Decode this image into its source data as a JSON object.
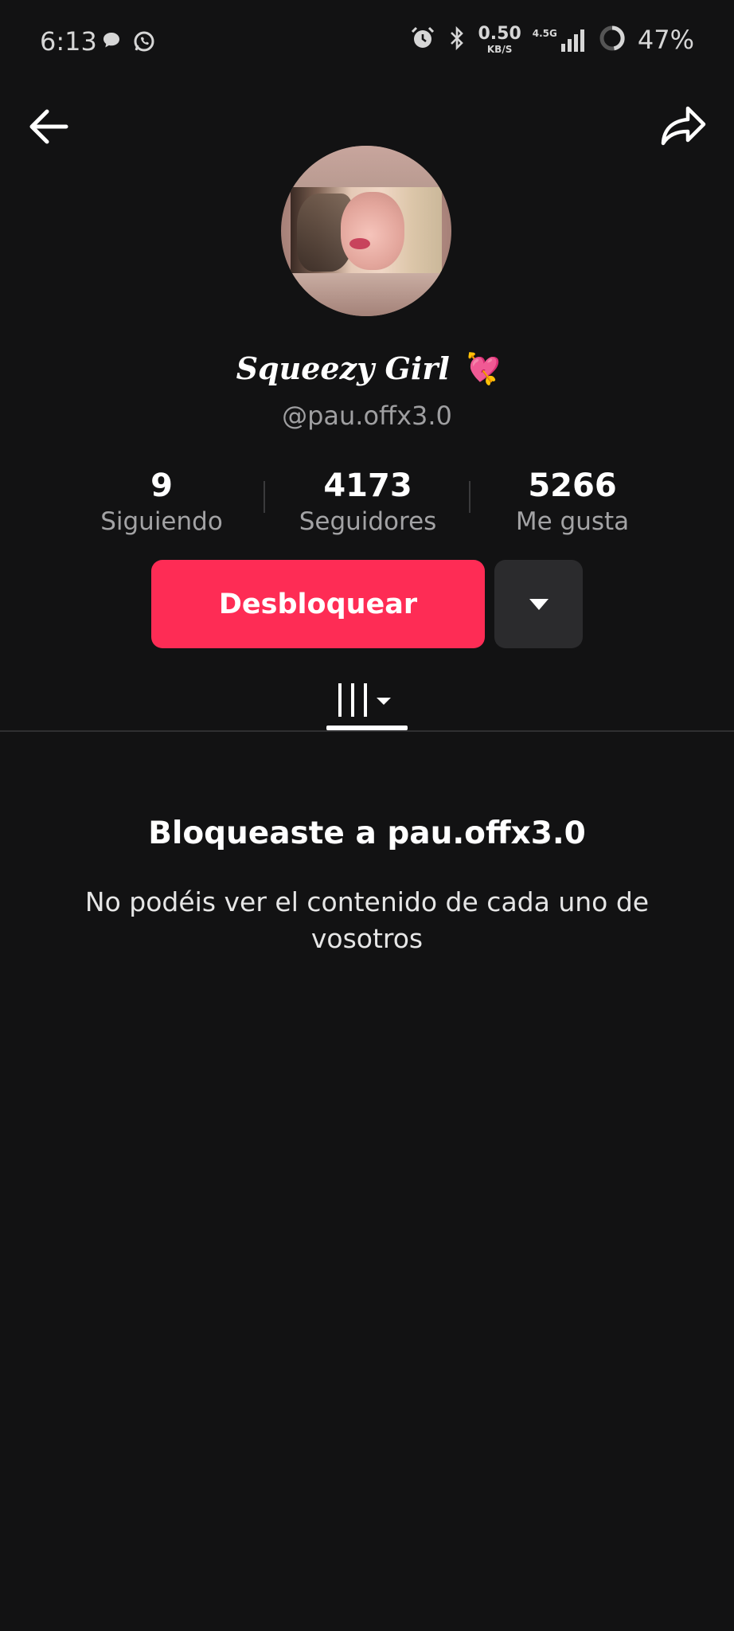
{
  "status_bar": {
    "time": "6:13",
    "net_speed_value": "0.50",
    "net_speed_unit": "KB/S",
    "network_type": "4.5G",
    "battery_percent": "47%",
    "icons": [
      "message-icon",
      "whatsapp-icon",
      "alarm-icon",
      "bluetooth-icon",
      "signal-icon",
      "battery-ring-icon"
    ]
  },
  "nav": {
    "back_icon": "arrow-left-icon",
    "share_icon": "share-arrow-icon"
  },
  "profile": {
    "display_name": "Squeezy Girl 💘",
    "username": "@pau.offx3.0"
  },
  "stats": [
    {
      "count": "9",
      "label": "Siguiendo"
    },
    {
      "count": "4173",
      "label": "Seguidores"
    },
    {
      "count": "5266",
      "label": "Me gusta"
    }
  ],
  "actions": {
    "unblock_label": "Desbloquear",
    "more_icon": "caret-down-icon",
    "unblock_color": "#fe2c55"
  },
  "tabs": {
    "videos_icon": "grid-lines-icon"
  },
  "empty_state": {
    "title": "Bloqueaste a pau.offx3.0",
    "description": "No podéis ver el contenido de cada uno de vosotros"
  }
}
